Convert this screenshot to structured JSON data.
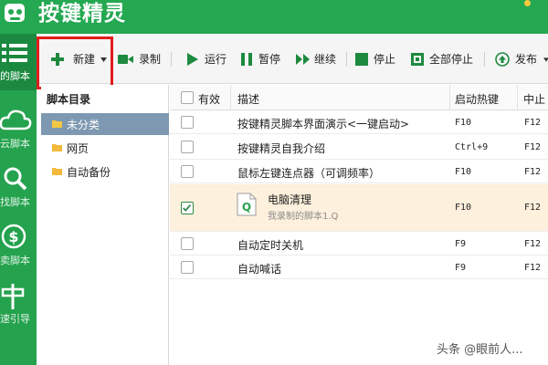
{
  "app": {
    "title": "按键精灵"
  },
  "nav": {
    "items": [
      {
        "label": "的脚本",
        "icon": "list-icon"
      },
      {
        "label": "云脚本",
        "icon": "cloud-icon"
      },
      {
        "label": "找脚本",
        "icon": "search-icon"
      },
      {
        "label": "卖脚本",
        "icon": "dollar-icon"
      },
      {
        "label": "速引导",
        "icon": "signpost-icon"
      }
    ]
  },
  "toolbar": {
    "new_label": "新建",
    "record_label": "录制",
    "run_label": "运行",
    "pause_label": "暂停",
    "continue_label": "继续",
    "stop_label": "停止",
    "stop_all_label": "全部停止",
    "publish_label": "发布"
  },
  "tree": {
    "title": "脚本目录",
    "items": [
      {
        "label": "未分类"
      },
      {
        "label": "网页"
      },
      {
        "label": "自动备份"
      }
    ]
  },
  "table": {
    "headers": {
      "enabled": "有效",
      "description": "描述",
      "hotkey": "启动热键",
      "stop_hotkey": "中止"
    },
    "rows": [
      {
        "description": "按键精灵脚本界面演示<一键启动>",
        "hotkey": "F10",
        "stop": "F12",
        "checked": false
      },
      {
        "description": "按键精灵自我介绍",
        "hotkey": "Ctrl+9",
        "stop": "F12",
        "checked": false
      },
      {
        "description": "鼠标左键连点器（可调频率）",
        "hotkey": "F10",
        "stop": "F12",
        "checked": false
      },
      {
        "description": "电脑清理",
        "subtitle": "我录制的脚本1.Q",
        "hotkey": "F10",
        "stop": "F12",
        "checked": true,
        "file_icon_letter": "Q"
      },
      {
        "description": "自动定时关机",
        "hotkey": "F9",
        "stop": "F12",
        "checked": false
      },
      {
        "description": "自动喊话",
        "hotkey": "F9",
        "stop": "F12",
        "checked": false
      }
    ]
  },
  "watermark": "头条 @眼前人...",
  "colors": {
    "brand_green": "#24a851",
    "nav_green": "#25a24e",
    "selected_tree": "#7d98b0",
    "selected_row": "#fdf0dc",
    "highlight_red": "#e21d1d"
  }
}
